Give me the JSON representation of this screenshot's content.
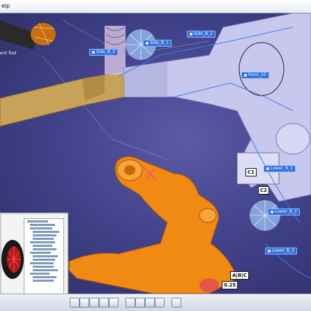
{
  "window": {
    "menu_fragment": "elp"
  },
  "viewport": {
    "tool_label": "ent Tool",
    "annotations": {
      "sido_b_1": "Sido_B_1",
      "sido_b_2": "Sido_B_2",
      "sido_b_3": "Sido_B_3",
      "point_20": "Point_20",
      "lower_b_1": "Lower_B_1",
      "lower_b_2": "Lower_B_2",
      "lower_b_3": "Lower_B_3"
    },
    "datum_labels": {
      "c1": "C1",
      "c2": "C2",
      "abc": "A|B|C",
      "dim": "0.25"
    }
  },
  "colors": {
    "background": "#3f3f86",
    "part_orange": "#f08a12",
    "part_lavender": "#c9c9ef",
    "part_tan": "#c9a45a",
    "annotation_blue": "#2f6fd6"
  },
  "icons": {
    "toolbar": [
      "select-icon",
      "pan-icon",
      "rotate-icon",
      "zoom-icon",
      "fit-all-icon",
      "normal-view-icon",
      "iso-view-icon",
      "hide-show-icon",
      "swap-icon",
      "render-style-icon"
    ]
  }
}
